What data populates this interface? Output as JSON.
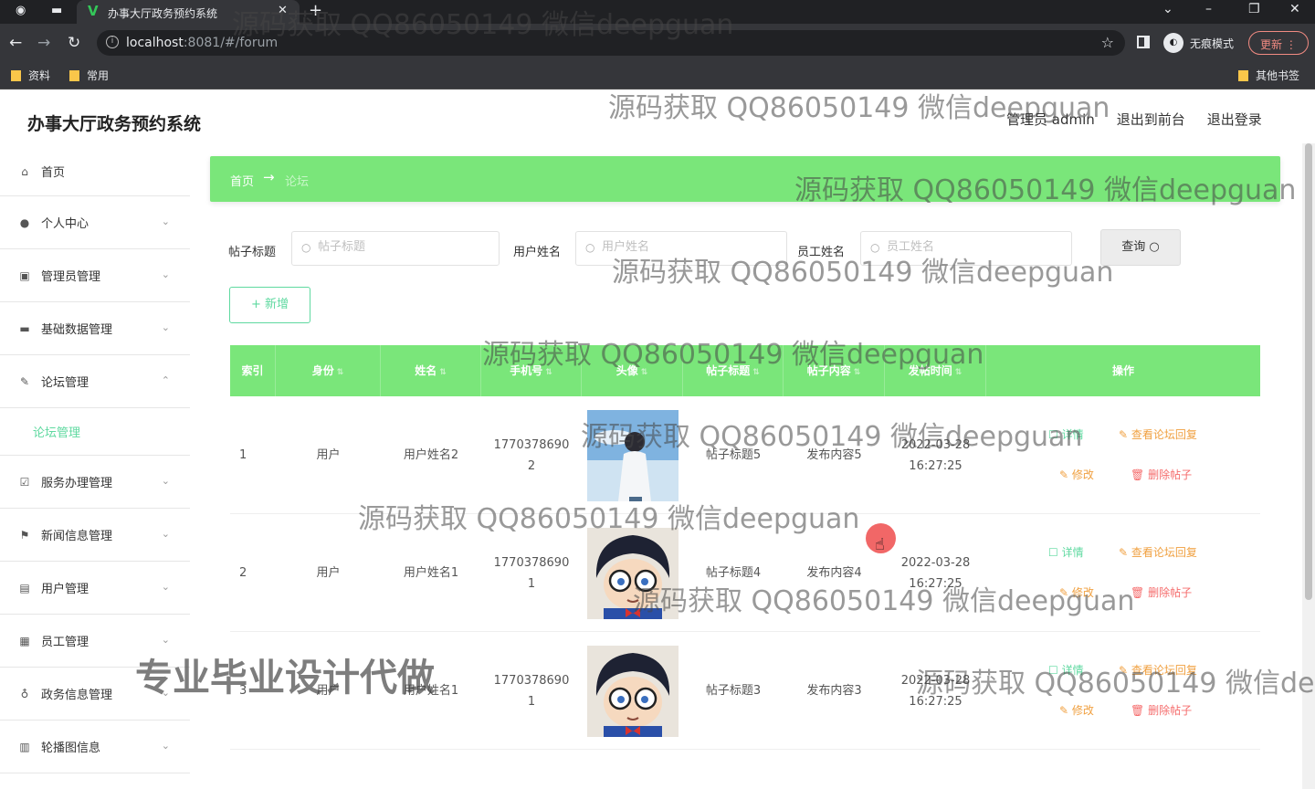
{
  "browser": {
    "tab_title": "办事大厅政务预约系统",
    "tab_favicon": "V",
    "url_host": "localhost",
    "url_rest": ":8081/#/forum",
    "incognito_label": "无痕模式",
    "update_label": "更新",
    "bookmarks": [
      "资料",
      "常用"
    ],
    "other_bookmarks": "其他书签"
  },
  "header": {
    "app_title": "办事大厅政务预约系统",
    "user": "管理员 admin",
    "back_to_front": "退出到前台",
    "logout": "退出登录"
  },
  "sidebar": {
    "items": [
      {
        "label": "首页"
      },
      {
        "label": "个人中心"
      },
      {
        "label": "管理员管理"
      },
      {
        "label": "基础数据管理"
      },
      {
        "label": "论坛管理"
      },
      {
        "label": "服务办理管理"
      },
      {
        "label": "新闻信息管理"
      },
      {
        "label": "用户管理"
      },
      {
        "label": "员工管理"
      },
      {
        "label": "政务信息管理"
      },
      {
        "label": "轮播图信息"
      }
    ],
    "active_sub": "论坛管理"
  },
  "breadcrumb": {
    "home": "首页",
    "current": "论坛"
  },
  "search": {
    "title_label": "帖子标题",
    "title_placeholder": "帖子标题",
    "user_label": "用户姓名",
    "user_placeholder": "用户姓名",
    "staff_label": "员工姓名",
    "staff_placeholder": "员工姓名",
    "query_label": "查询"
  },
  "toolbar": {
    "add_label": "+ 新增"
  },
  "table": {
    "headers": [
      "索引",
      "身份",
      "姓名",
      "手机号",
      "头像",
      "帖子标题",
      "帖子内容",
      "发帖时间",
      "操作"
    ],
    "rows": [
      {
        "index": "1",
        "role": "用户",
        "name": "用户姓名2",
        "phone_a": "1770378690",
        "phone_b": "2",
        "title": "帖子标题5",
        "content": "发布内容5",
        "date": "2022-03-28",
        "time": "16:27:25",
        "avatar": "boy"
      },
      {
        "index": "2",
        "role": "用户",
        "name": "用户姓名1",
        "phone_a": "1770378690",
        "phone_b": "1",
        "title": "帖子标题4",
        "content": "发布内容4",
        "date": "2022-03-28",
        "time": "16:27:25",
        "avatar": "conan"
      },
      {
        "index": "3",
        "role": "用户",
        "name": "用户姓名1",
        "phone_a": "1770378690",
        "phone_b": "1",
        "title": "帖子标题3",
        "content": "发布内容3",
        "date": "2022-03-28",
        "time": "16:27:25",
        "avatar": "conan"
      }
    ],
    "ops": {
      "detail": "详情",
      "view_replies": "查看论坛回复",
      "edit": "修改",
      "delete": "删除帖子"
    }
  },
  "watermark": {
    "text": "源码获取 QQ86050149 微信deepguan",
    "big_text": "专业毕业设计代做"
  },
  "colors": {
    "accent_green": "#7ae67a",
    "link_green": "#5fd9a0",
    "warn_orange": "#f0a040",
    "danger_red": "#f56c6c"
  }
}
